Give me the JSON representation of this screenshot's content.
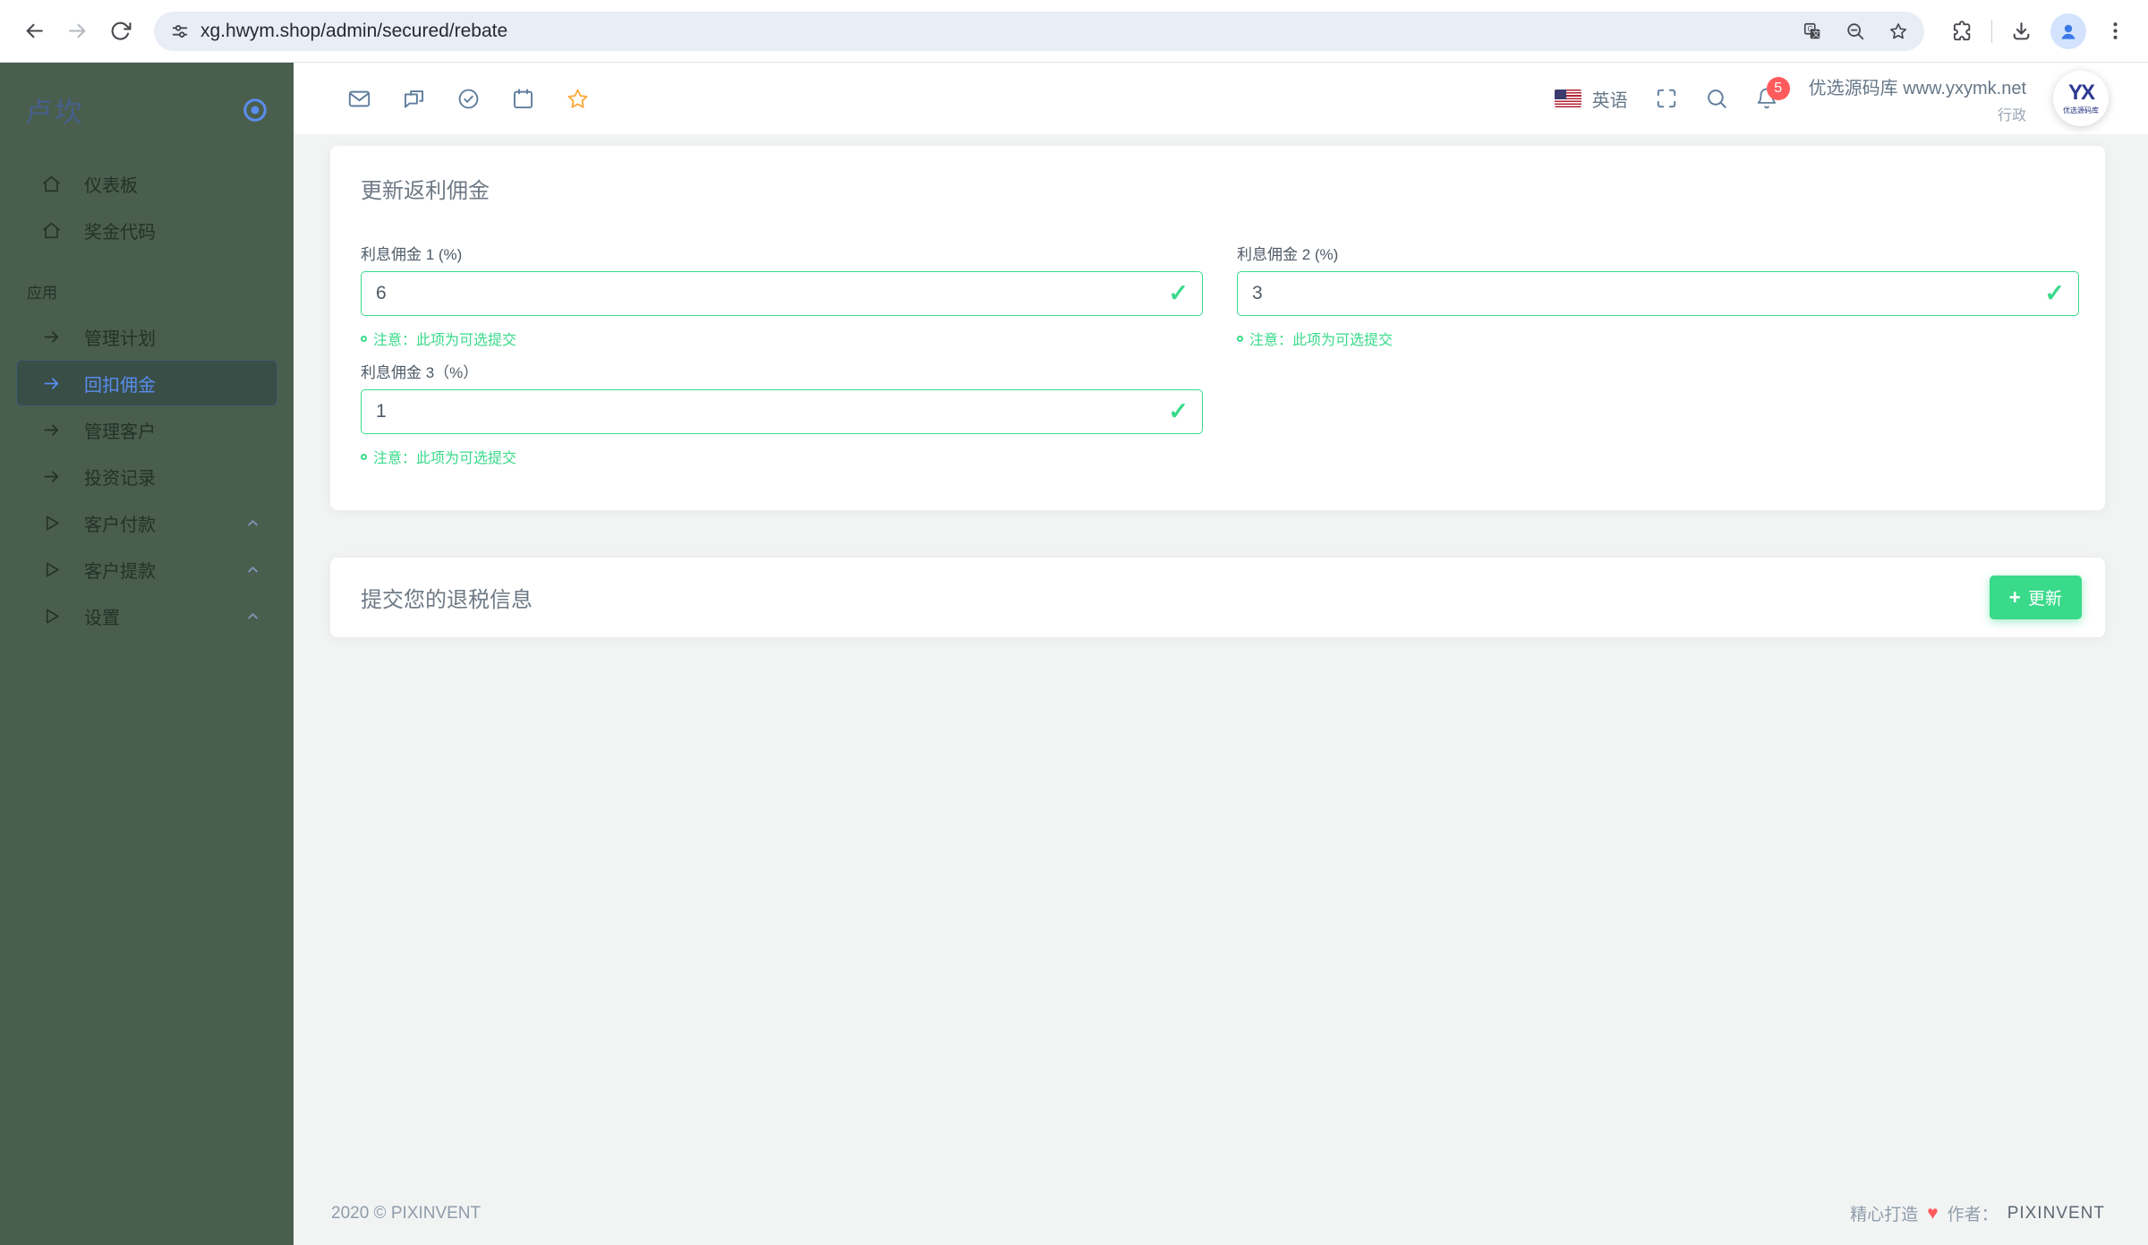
{
  "browser": {
    "url": "xg.hwym.shop/admin/secured/rebate"
  },
  "sidebar": {
    "brand": "卢坎",
    "section_label": "应用",
    "items": [
      {
        "label": "仪表板",
        "icon": "home"
      },
      {
        "label": "奖金代码",
        "icon": "home"
      },
      {
        "label": "管理计划",
        "icon": "arrow-right"
      },
      {
        "label": "回扣佣金",
        "icon": "arrow-right",
        "active": true
      },
      {
        "label": "管理客户",
        "icon": "arrow-right"
      },
      {
        "label": "投资记录",
        "icon": "arrow-right"
      },
      {
        "label": "客户付款",
        "icon": "triangle-right",
        "caret": "up"
      },
      {
        "label": "客户提款",
        "icon": "triangle-right",
        "caret": "up"
      },
      {
        "label": "设置",
        "icon": "triangle-right",
        "caret": "up"
      }
    ]
  },
  "topbar": {
    "language": "英语",
    "notification_count": "5",
    "user_name": "优选源码库 www.yxymk.net",
    "user_role": "行政",
    "avatar_monogram": "YX",
    "avatar_caption": "优选源码库"
  },
  "rebate_card": {
    "title": "更新返利佣金",
    "fields": [
      {
        "label": "利息佣金 1 (%)",
        "value": "6",
        "note": "注意：此项为可选提交"
      },
      {
        "label": "利息佣金 2 (%)",
        "value": "3",
        "note": "注意：此项为可选提交"
      },
      {
        "label": "利息佣金 3（%）",
        "value": "1",
        "note": "注意：此项为可选提交"
      }
    ],
    "valid_mark": "✓"
  },
  "submit_card": {
    "title": "提交您的退税信息",
    "button_icon": "+",
    "button_label": "更新"
  },
  "footer": {
    "left": "2020 © PIXINVENT",
    "made": "精心打造",
    "heart": "♥",
    "author_label": "作者：",
    "brand": "PIXINVENT"
  },
  "colors": {
    "primary": "#5a8dee",
    "success": "#39da8a",
    "danger": "#ff5b5c",
    "warning": "#fdac41",
    "sidebar_bg": "#4a5e4d",
    "page_bg": "#f2f4f4"
  }
}
